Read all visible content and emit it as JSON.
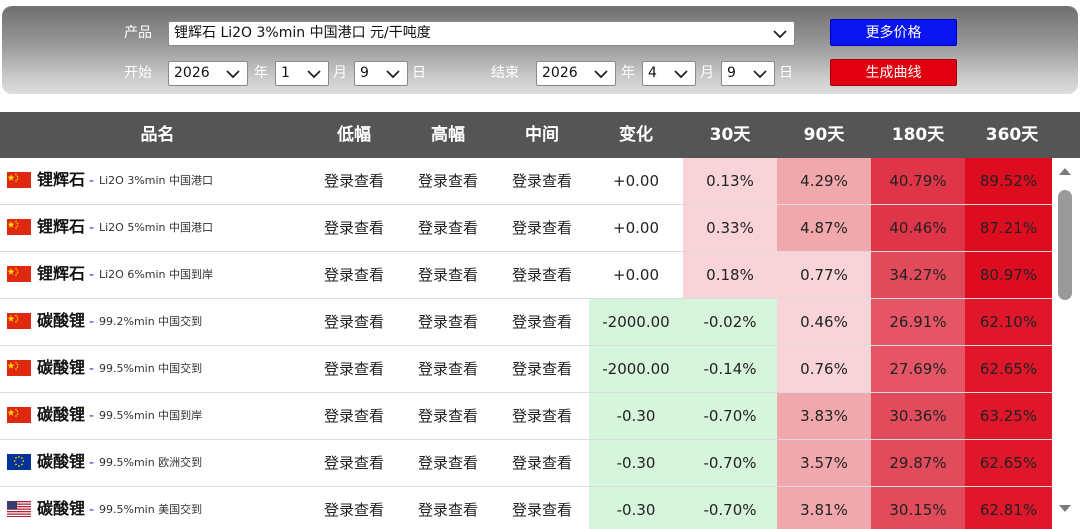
{
  "filters": {
    "product_label": "产品",
    "product_value": "锂辉石 Li2O 3%min 中国港口 元/干吨度",
    "start_label": "开始",
    "start_year": "2026",
    "start_month": "1",
    "start_day": "9",
    "end_label": "结束",
    "end_year": "2026",
    "end_month": "4",
    "end_day": "9",
    "year_unit": "年",
    "month_unit": "月",
    "day_unit": "日",
    "more_prices_label": "更多价格",
    "generate_curve_label": "生成曲线"
  },
  "colors": {
    "header_bg": "#555555",
    "green_cell": "#d6f5dc",
    "blue_button": "#0a14f0",
    "red_button": "#e0000f"
  },
  "table": {
    "columns": [
      "品名",
      "低幅",
      "高幅",
      "中间",
      "变化",
      "30天",
      "90天",
      "180天",
      "360天"
    ],
    "rows": [
      {
        "flag": "china-flag-icon",
        "name": "锂辉石",
        "spec": "Li2O 3%min 中国港口",
        "low": "登录查看",
        "high": "登录查看",
        "mid": "登录查看",
        "change": "+0.00",
        "d30": "0.13%",
        "d90": "4.29%",
        "d180": "40.79%",
        "d360": "89.52%",
        "c_change": "#ffffff",
        "c30": "#f8d3d8",
        "c90": "#f0a8ad",
        "c180": "#e03548",
        "c360": "#de0c1f"
      },
      {
        "flag": "china-flag-icon",
        "name": "锂辉石",
        "spec": "Li2O 5%min 中国港口",
        "low": "登录查看",
        "high": "登录查看",
        "mid": "登录查看",
        "change": "+0.00",
        "d30": "0.33%",
        "d90": "4.87%",
        "d180": "40.46%",
        "d360": "87.21%",
        "c_change": "#ffffff",
        "c30": "#f8d3d8",
        "c90": "#f0a8ad",
        "c180": "#e03548",
        "c360": "#de0c1f"
      },
      {
        "flag": "china-flag-icon",
        "name": "锂辉石",
        "spec": "Li2O 6%min 中国到岸",
        "low": "登录查看",
        "high": "登录查看",
        "mid": "登录查看",
        "change": "+0.00",
        "d30": "0.18%",
        "d90": "0.77%",
        "d180": "34.27%",
        "d360": "80.97%",
        "c_change": "#ffffff",
        "c30": "#f8d3d8",
        "c90": "#f8d3d8",
        "c180": "#e14a5a",
        "c360": "#de0c1f"
      },
      {
        "flag": "china-flag-icon",
        "name": "碳酸锂",
        "spec": "99.2%min 中国交到",
        "low": "登录查看",
        "high": "登录查看",
        "mid": "登录查看",
        "change": "-2000.00",
        "d30": "-0.02%",
        "d90": "0.46%",
        "d180": "26.91%",
        "d360": "62.10%",
        "c_change": "#d6f5dc",
        "c30": "#d6f5dc",
        "c90": "#f8d3d8",
        "c180": "#e55566",
        "c360": "#e0162a"
      },
      {
        "flag": "china-flag-icon",
        "name": "碳酸锂",
        "spec": "99.5%min 中国交到",
        "low": "登录查看",
        "high": "登录查看",
        "mid": "登录查看",
        "change": "-2000.00",
        "d30": "-0.14%",
        "d90": "0.76%",
        "d180": "27.69%",
        "d360": "62.65%",
        "c_change": "#d6f5dc",
        "c30": "#d6f5dc",
        "c90": "#f8d3d8",
        "c180": "#e55566",
        "c360": "#e0162a"
      },
      {
        "flag": "china-flag-icon",
        "name": "碳酸锂",
        "spec": "99.5%min 中国到岸",
        "low": "登录查看",
        "high": "登录查看",
        "mid": "登录查看",
        "change": "-0.30",
        "d30": "-0.70%",
        "d90": "3.83%",
        "d180": "30.36%",
        "d360": "63.25%",
        "c_change": "#d6f5dc",
        "c30": "#d6f5dc",
        "c90": "#f0a8ad",
        "c180": "#e24b5c",
        "c360": "#e0162a"
      },
      {
        "flag": "eu-flag-icon",
        "name": "碳酸锂",
        "spec": "99.5%min 欧洲交到",
        "low": "登录查看",
        "high": "登录查看",
        "mid": "登录查看",
        "change": "-0.30",
        "d30": "-0.70%",
        "d90": "3.57%",
        "d180": "29.87%",
        "d360": "62.65%",
        "c_change": "#d6f5dc",
        "c30": "#d6f5dc",
        "c90": "#f0a8ad",
        "c180": "#e24b5c",
        "c360": "#e0162a"
      },
      {
        "flag": "usa-flag-icon",
        "name": "碳酸锂",
        "spec": "99.5%min 美国交到",
        "low": "登录查看",
        "high": "登录查看",
        "mid": "登录查看",
        "change": "-0.30",
        "d30": "-0.70%",
        "d90": "3.81%",
        "d180": "30.15%",
        "d360": "62.81%",
        "c_change": "#d6f5dc",
        "c30": "#d6f5dc",
        "c90": "#f0a8ad",
        "c180": "#e24b5c",
        "c360": "#e0162a"
      }
    ]
  }
}
